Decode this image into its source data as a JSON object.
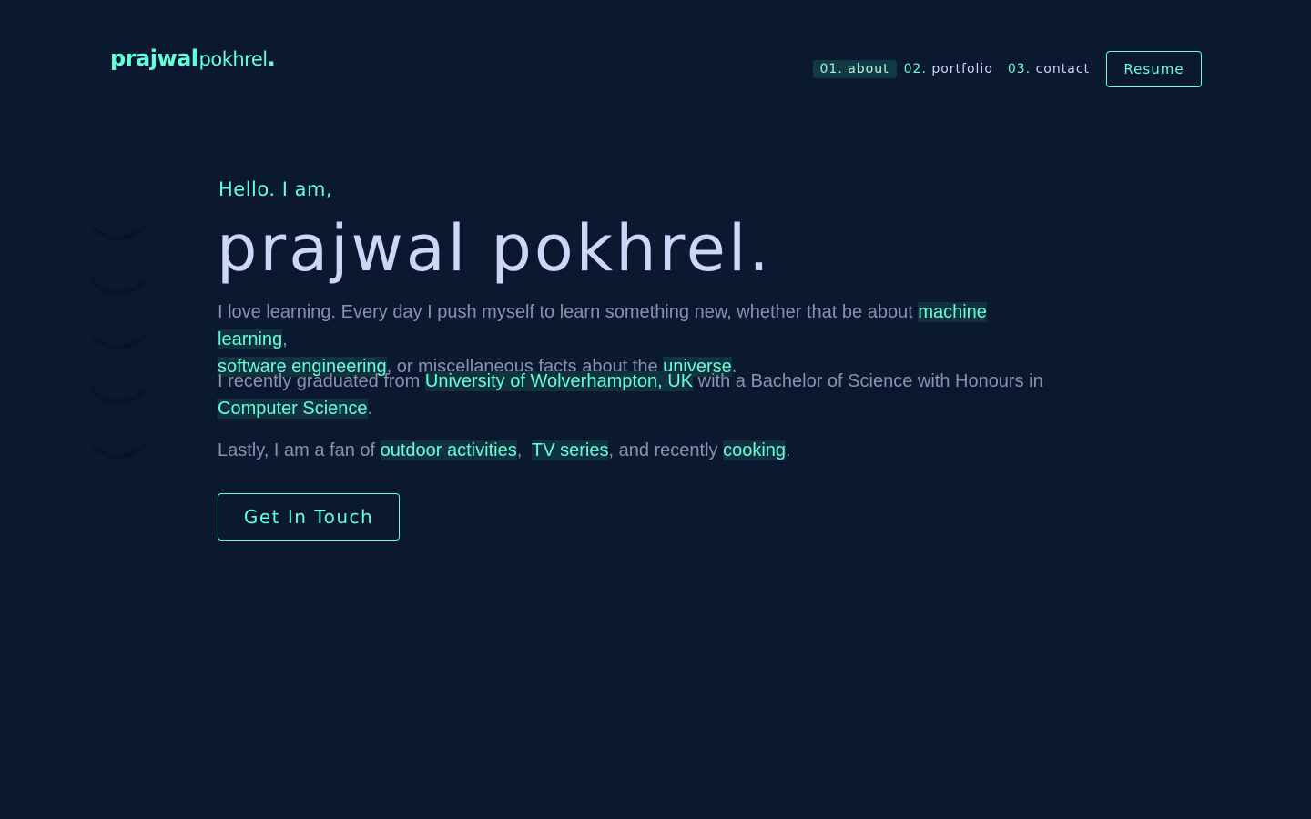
{
  "header": {
    "logo_first": "prajwal",
    "logo_last": "pokhrel",
    "logo_dot": ".",
    "nav": [
      {
        "num": "01.",
        "label": "about",
        "active": true
      },
      {
        "num": "02.",
        "label": "portfolio",
        "active": false
      },
      {
        "num": "03.",
        "label": "contact",
        "active": false
      }
    ],
    "resume_label": "Resume"
  },
  "hero": {
    "greeting": "Hello. I am,",
    "name": "prajwal pokhrel.",
    "p1": {
      "t1": "I love learning. Every day I push myself to learn something new, whether that be about ",
      "h1": "machine learning",
      "t2": ", ",
      "h2": "software engineering",
      "t3": ", or miscellaneous facts about the ",
      "h3": "universe",
      "t4": "."
    },
    "p2": {
      "t1": "I recently graduated from ",
      "h1": "University of Wolverhampton, UK",
      "t2": " with a Bachelor of Science with Honours in ",
      "h2": "Computer Science",
      "t3": "."
    },
    "p3": {
      "t1": "Lastly, I am a fan of ",
      "h1": "outdoor activities",
      "t2": ",  ",
      "h2": "TV series",
      "t3": ", and recently ",
      "h3": "cooking",
      "t4": "."
    },
    "cta_label": "Get In Touch"
  },
  "colors": {
    "background": "#0a192f",
    "accent": "#64ffda",
    "heading": "#ccd6f6",
    "body_text": "#8892b0"
  }
}
